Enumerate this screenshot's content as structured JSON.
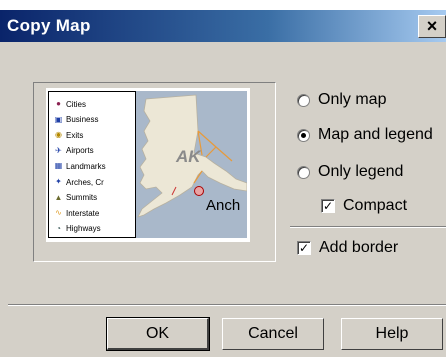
{
  "window": {
    "title": "Copy Map",
    "close_label": "×"
  },
  "preview": {
    "legend_items": [
      {
        "icon": "cities-icon",
        "glyph": "●",
        "color": "#8b2252",
        "label": "Cities"
      },
      {
        "icon": "business-icon",
        "glyph": "▣",
        "color": "#1f3fa6",
        "label": "Business"
      },
      {
        "icon": "exits-icon",
        "glyph": "◉",
        "color": "#b58900",
        "label": "Exits"
      },
      {
        "icon": "airports-icon",
        "glyph": "✈",
        "color": "#1f3fa6",
        "label": "Airports"
      },
      {
        "icon": "landmarks-icon",
        "glyph": "▦",
        "color": "#1f3fa6",
        "label": "Landmarks"
      },
      {
        "icon": "arches-icon",
        "glyph": "✦",
        "color": "#1f3fa6",
        "label": "Arches, Cr"
      },
      {
        "icon": "summits-icon",
        "glyph": "▲",
        "color": "#6b6b2f",
        "label": "Summits"
      },
      {
        "icon": "interstate-icon",
        "glyph": "∿",
        "color": "#e0a030",
        "label": "Interstate"
      },
      {
        "icon": "highways-icon",
        "glyph": "◔",
        "color": "#2f4f4f",
        "label": "Highways"
      }
    ],
    "map_state_label": "AK",
    "map_city_label": "Anch"
  },
  "options": {
    "only_map": {
      "label": "Only map",
      "checked": false
    },
    "map_and_legend": {
      "label": "Map and legend",
      "checked": true
    },
    "only_legend": {
      "label": "Only legend",
      "checked": false
    },
    "compact": {
      "label": "Compact",
      "checked": true
    },
    "add_border": {
      "label": "Add border",
      "checked": true
    }
  },
  "buttons": {
    "ok": "OK",
    "cancel": "Cancel",
    "help": "Help"
  }
}
